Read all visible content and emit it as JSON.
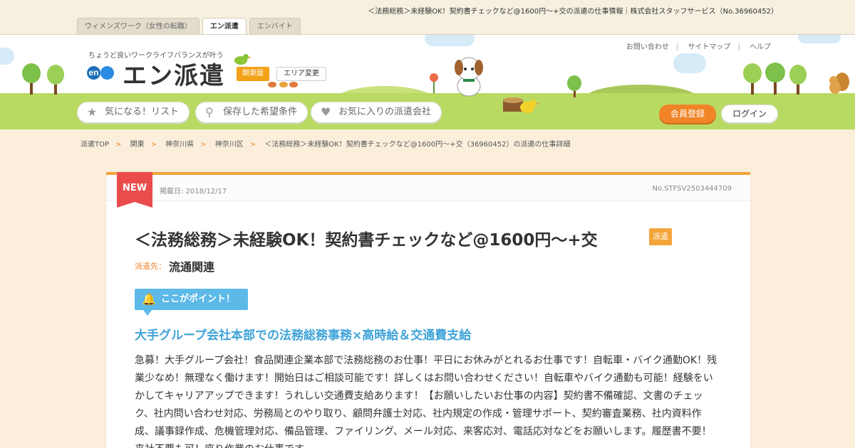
{
  "page_title": "＜法務総務＞未経験OK！契約書チェックなど@1600円～+交の派遣の仕事情報｜株式会社スタッフサービス（No.36960452）",
  "site_tabs": [
    {
      "label": "ウィメンズワーク（女性の転職）"
    },
    {
      "label": "エン派遣",
      "active": true
    },
    {
      "label": "エンバイト"
    }
  ],
  "header": {
    "tagline": "ちょうど良いワークライフバランスが叶う",
    "logo_mark": "en",
    "logo_text": "エン派遣",
    "region_badge": "関東版",
    "area_change": "エリア変更",
    "util_links": [
      "お問い合わせ",
      "サイトマップ",
      "ヘルプ"
    ],
    "nav": [
      {
        "label": "気になる！リスト",
        "icon": "star-icon"
      },
      {
        "label": "保存した希望条件",
        "icon": "search-icon"
      },
      {
        "label": "お気に入りの派遣会社",
        "icon": "heart-icon"
      }
    ],
    "member_button": "会員登録",
    "login_button": "ログイン"
  },
  "breadcrumb": [
    "派遣TOP",
    "関東",
    "神奈川県",
    "神奈川区",
    "＜法務総務＞未経験OK！契約書チェックなど@1600円～+交（36960452）の派遣の仕事詳細"
  ],
  "job": {
    "new_badge": "NEW",
    "posted": "掲載日: 2018/12/17",
    "job_no": "No.STFSV2503444709",
    "title": "＜法務総務＞未経験OK！契約書チェックなど@1600円～+交",
    "type_badge": "派遣",
    "destination_label": "派遣先：",
    "destination": "流通関連",
    "point_label": "ここがポイント！",
    "catch_copy": "大手グループ会社本部での法務総務事務×高時給＆交通費支給",
    "description": "急募！大手グループ会社！食品関連企業本部で法務総務のお仕事！平日にお休みがとれるお仕事です！自転車・バイク通勤OK！残業少なめ！無理なく働けます！開始日はご相談可能です！詳しくはお問い合わせください！自転車やバイク通勤も可能！経験をいかしてキャリアアップできます！うれしい交通費支給あります！【お願いしたいお仕事の内容】契約書不備確認、文書のチェック、社内問い合わせ対応、労務局とのやり取り、顧問弁護士対応、社内規定の作成・管理サポート、契約審査業務、社内資料作成、議事録作成、危機管理対応、備品管理、ファイリング、メール対応、来客応対、電話応対などをお願いします。履歴書不要！来社不要も可！座り作業のお仕事です。"
  },
  "colors": {
    "accent": "#f3a53a",
    "new_red": "#ea4c4c",
    "point_blue": "#5cb9e8",
    "catch_blue": "#3fa3d8",
    "member_orange": "#f08427"
  }
}
